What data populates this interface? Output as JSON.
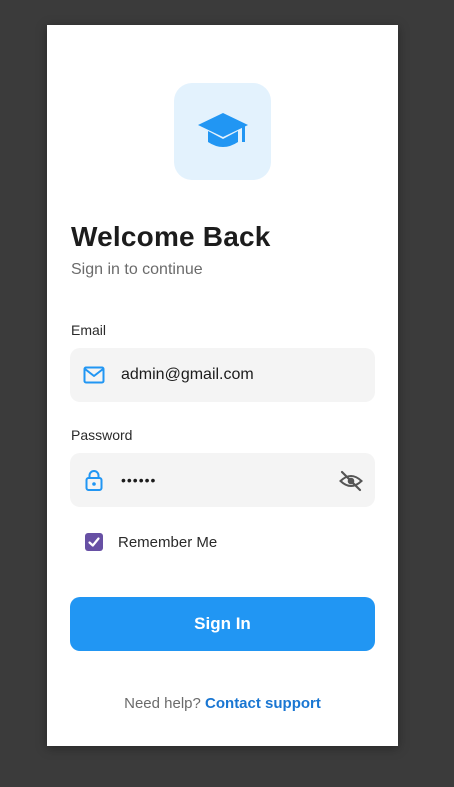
{
  "header": {
    "title": "Welcome Back",
    "subtitle": "Sign in to continue"
  },
  "logo": {
    "icon": "graduation-cap-icon",
    "background": "#e3f2fd",
    "color": "#2196f3"
  },
  "email": {
    "label": "Email",
    "value": "admin@gmail.com",
    "icon": "email-icon"
  },
  "password": {
    "label": "Password",
    "value": "••••••",
    "icon": "lock-icon",
    "toggle_icon": "visibility-off-icon"
  },
  "remember": {
    "label": "Remember Me",
    "checked": true
  },
  "signin": {
    "label": "Sign In"
  },
  "help": {
    "prompt": "Need help?",
    "link": "Contact support"
  },
  "colors": {
    "primary": "#2196f3",
    "checkbox": "#6750a4",
    "link": "#1976d2"
  }
}
